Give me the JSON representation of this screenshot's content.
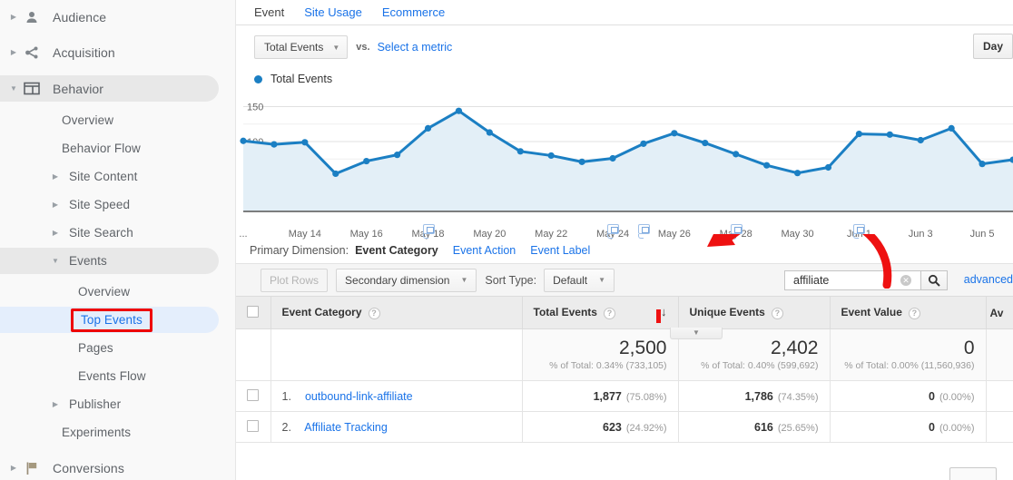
{
  "sidebar": {
    "items": [
      {
        "label": "Audience",
        "icon": "person-icon",
        "level": 1,
        "caret": "right",
        "state": "normal"
      },
      {
        "label": "Acquisition",
        "icon": "share-icon",
        "level": 1,
        "caret": "right",
        "state": "normal"
      },
      {
        "label": "Behavior",
        "icon": "window-icon",
        "level": 1,
        "caret": "down",
        "state": "expanded"
      },
      {
        "label": "Overview",
        "icon": "",
        "level": 2,
        "caret": "none",
        "state": "normal"
      },
      {
        "label": "Behavior Flow",
        "icon": "",
        "level": 2,
        "caret": "none",
        "state": "normal"
      },
      {
        "label": "Site Content",
        "icon": "",
        "level": 2,
        "caret": "right",
        "state": "normal"
      },
      {
        "label": "Site Speed",
        "icon": "",
        "level": 2,
        "caret": "right",
        "state": "normal"
      },
      {
        "label": "Site Search",
        "icon": "",
        "level": 2,
        "caret": "right",
        "state": "normal"
      },
      {
        "label": "Events",
        "icon": "",
        "level": 2,
        "caret": "down",
        "state": "expanded"
      },
      {
        "label": "Overview",
        "icon": "",
        "level": 3,
        "caret": "none",
        "state": "normal"
      },
      {
        "label": "Top Events",
        "icon": "",
        "level": 3,
        "caret": "none",
        "state": "selected-highlighted"
      },
      {
        "label": "Pages",
        "icon": "",
        "level": 3,
        "caret": "none",
        "state": "normal"
      },
      {
        "label": "Events Flow",
        "icon": "",
        "level": 3,
        "caret": "none",
        "state": "normal"
      },
      {
        "label": "Publisher",
        "icon": "",
        "level": 2,
        "caret": "right",
        "state": "normal"
      },
      {
        "label": "Experiments",
        "icon": "",
        "level": 2,
        "caret": "none",
        "state": "normal"
      },
      {
        "label": "Conversions",
        "icon": "flag-icon",
        "level": 1,
        "caret": "right",
        "state": "normal"
      }
    ],
    "highlight_color": "#ee0000",
    "selected_bg": "#e4eefc"
  },
  "tabs": [
    {
      "label": "Event",
      "active": true
    },
    {
      "label": "Site Usage",
      "active": false
    },
    {
      "label": "Ecommerce",
      "active": false
    }
  ],
  "metric_bar": {
    "primary_metric": "Total Events",
    "vs_label": "vs.",
    "select_metric_link": "Select a metric",
    "granularity_button": "Day"
  },
  "legend": {
    "label": "Total Events",
    "color": "#1b7fc3"
  },
  "chart_data": {
    "type": "line",
    "title": "Total Events",
    "xlabel": "",
    "ylabel": "",
    "ylim": [
      0,
      165
    ],
    "yticks": [
      50,
      100,
      150
    ],
    "grid": true,
    "legend": [
      "Total Events"
    ],
    "legend_position": "top-left",
    "series_color": "#1b7fc3",
    "fill_color": "#e3eff7",
    "x_tick_labels": [
      "...",
      "May 14",
      "May 16",
      "May 18",
      "May 20",
      "May 22",
      "May 24",
      "May 26",
      "May 28",
      "May 30",
      "Jun 1",
      "Jun 3",
      "Jun 5"
    ],
    "annotation_markers_at": [
      "May 18",
      "May 24",
      "May 25",
      "May 28",
      "Jun 1"
    ],
    "x": [
      "May 12",
      "May 13",
      "May 14",
      "May 15",
      "May 16",
      "May 17",
      "May 18",
      "May 19",
      "May 20",
      "May 21",
      "May 22",
      "May 23",
      "May 24",
      "May 25",
      "May 26",
      "May 27",
      "May 28",
      "May 29",
      "May 30",
      "May 31",
      "Jun 1",
      "Jun 2",
      "Jun 3",
      "Jun 4",
      "Jun 5",
      "Jun 6"
    ],
    "values": [
      101,
      96,
      99,
      54,
      72,
      81,
      119,
      144,
      113,
      86,
      80,
      71,
      76,
      97,
      112,
      98,
      82,
      66,
      55,
      63,
      111,
      110,
      102,
      119,
      68,
      74
    ]
  },
  "primary_dimension": {
    "label": "Primary Dimension:",
    "options": [
      {
        "label": "Event Category",
        "active": true
      },
      {
        "label": "Event Action",
        "active": false
      },
      {
        "label": "Event Label",
        "active": false
      }
    ]
  },
  "toolbar": {
    "plot_rows_label": "Plot Rows",
    "secondary_dimension_label": "Secondary dimension",
    "sort_type_label": "Sort Type:",
    "sort_type_value": "Default",
    "search_value": "affiliate",
    "search_placeholder": "",
    "advanced_link": "advanced"
  },
  "table": {
    "columns": [
      {
        "label": "Event Category",
        "help": true,
        "sorted": false
      },
      {
        "label": "Total Events",
        "help": true,
        "sorted": true,
        "sort_dir": "desc"
      },
      {
        "label": "Unique Events",
        "help": true,
        "sorted": false
      },
      {
        "label": "Event Value",
        "help": true,
        "sorted": false
      },
      {
        "label": "Av",
        "help": false,
        "sorted": false,
        "truncated": true
      }
    ],
    "summary": {
      "total_events": {
        "value": "2,500",
        "pct": "% of Total: 0.34% (733,105)"
      },
      "unique_events": {
        "value": "2,402",
        "pct": "% of Total: 0.40% (599,692)"
      },
      "event_value": {
        "value": "0",
        "pct": "% of Total: 0.00% (11,560,936)"
      }
    },
    "rows": [
      {
        "index": "1.",
        "name": "outbound-link-affiliate",
        "total_events": "1,877",
        "total_events_pct": "(75.08%)",
        "unique_events": "1,786",
        "unique_events_pct": "(74.35%)",
        "event_value": "0",
        "event_value_pct": "(0.00%)"
      },
      {
        "index": "2.",
        "name": "Affiliate Tracking",
        "total_events": "623",
        "total_events_pct": "(24.92%)",
        "unique_events": "616",
        "unique_events_pct": "(25.65%)",
        "event_value": "0",
        "event_value_pct": "(0.00%)"
      }
    ]
  },
  "annotation_overlay": {
    "arrow_color": "#ee1111",
    "description": "red curved arrow pointing at Event Category"
  }
}
